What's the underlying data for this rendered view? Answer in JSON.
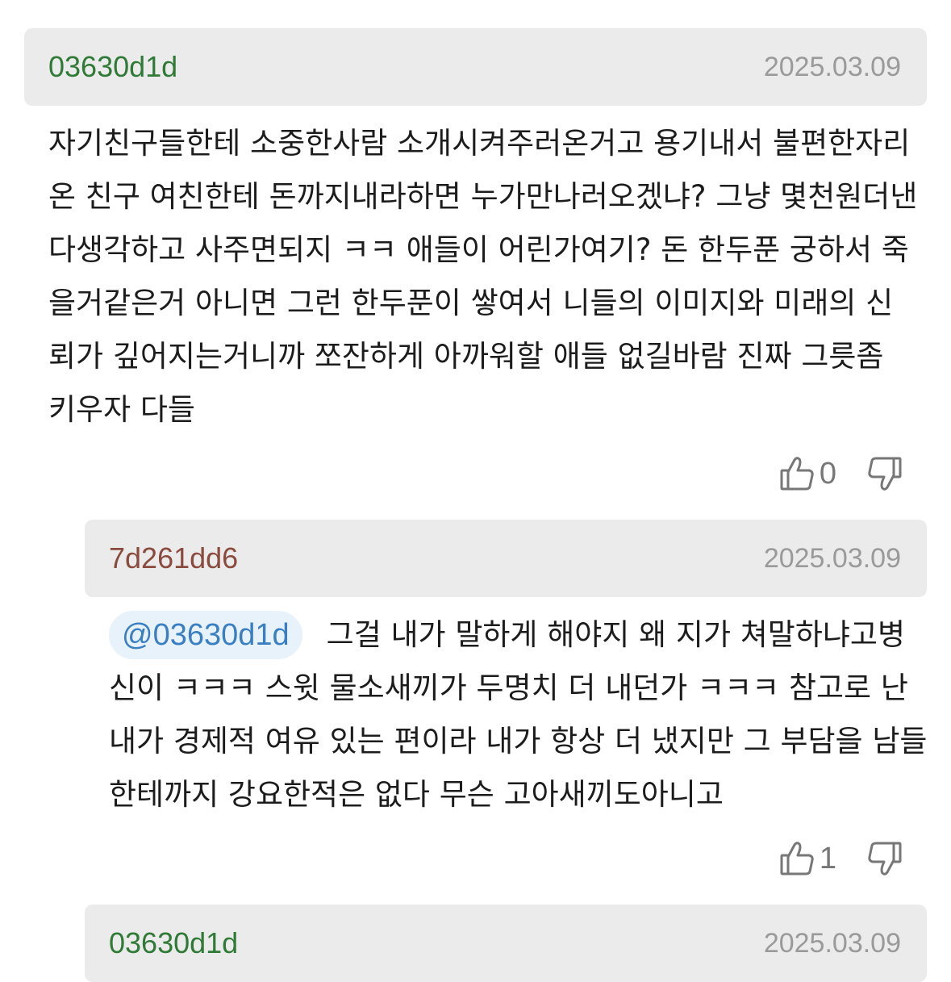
{
  "comments": [
    {
      "author": "03630d1d",
      "author_color": "#2f7a36",
      "date": "2025.03.09",
      "text": "자기친구들한테 소중한사람 소개시켜주러온거고 용기내서 불편한자리온 친구 여친한테 돈까지내라하면 누가만나러오겠냐? 그냥 몇천원더낸다생각하고 사주면되지 ㅋㅋ 애들이 어린가여기? 돈 한두푼 궁하서 죽을거같은거 아니면 그런 한두푼이 쌓여서 니들의 이미지와 미래의 신뢰가 깊어지는거니까 쪼잔하게 아까워할 애들 없길바람 진짜 그릇좀 키우자 다들",
      "like_count": "0"
    },
    {
      "author": "7d261dd6",
      "author_color": "#8a4a3e",
      "date": "2025.03.09",
      "mention": "@03630d1d",
      "text": "그걸 내가 말하게 해야지 왜 지가 쳐말하냐고병신이 ㅋㅋㅋ 스윗 물소새끼가 두명치 더 내던가 ㅋㅋㅋ 참고로 난 내가 경제적 여유 있는 편이라 내가 항상 더 냈지만 그 부담을 남들한테까지 강요한적은 없다 무슨 고아새끼도아니고",
      "like_count": "1"
    },
    {
      "author": "03630d1d",
      "author_color": "#2f7a36",
      "date": "2025.03.09"
    }
  ]
}
